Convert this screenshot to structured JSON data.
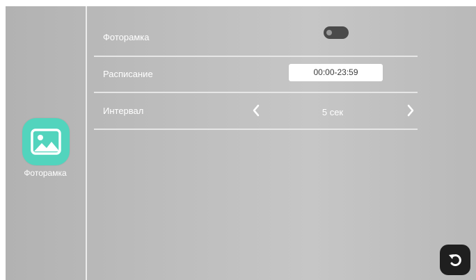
{
  "sidebar": {
    "app_label": "Фоторамка",
    "app_icon": "picture-frame-icon",
    "accent_color": "#52d4bd"
  },
  "settings": {
    "photo_frame": {
      "label": "Фоторамка",
      "enabled": false
    },
    "schedule": {
      "label": "Расписание",
      "value": "00:00-23:59"
    },
    "interval": {
      "label": "Интервал",
      "value": "5 сек",
      "prev_icon": "chevron-left-icon",
      "next_icon": "chevron-right-icon"
    }
  },
  "controls": {
    "back_icon": "back-arrow-icon"
  }
}
